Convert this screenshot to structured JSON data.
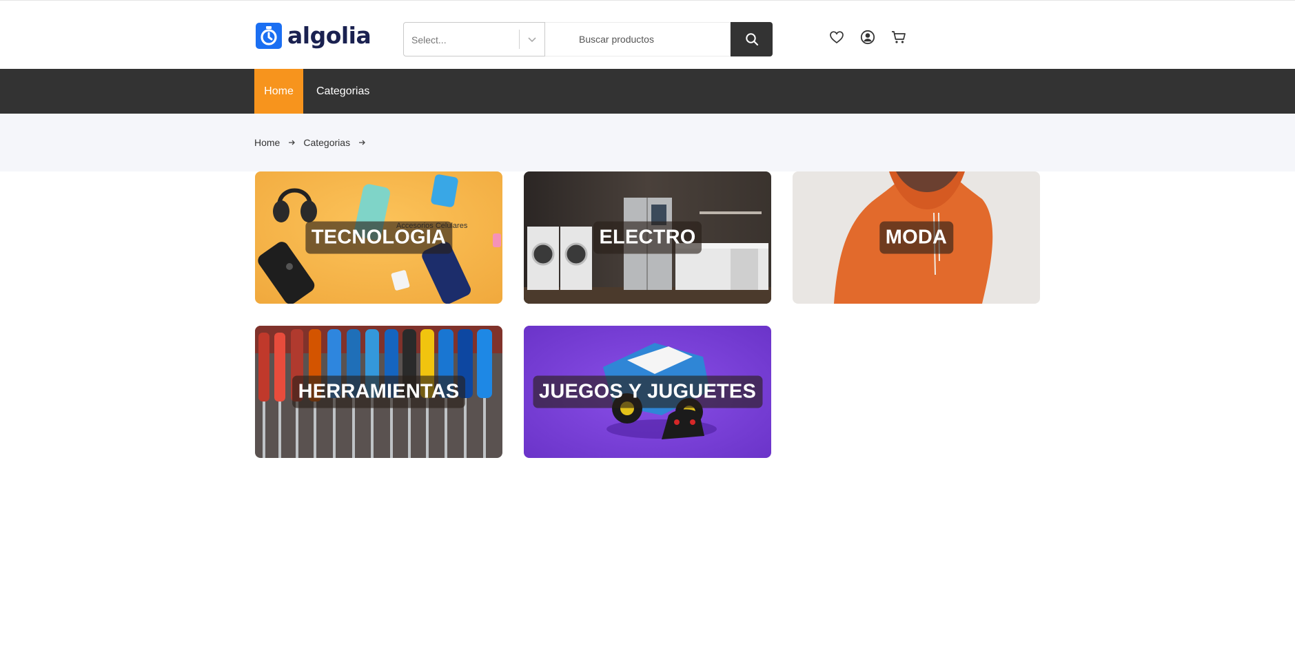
{
  "header": {
    "logo_text": "algolia",
    "select_placeholder": "Select...",
    "search_placeholder": "Buscar productos",
    "icons": [
      "heart-icon",
      "user-icon",
      "cart-icon"
    ]
  },
  "nav": {
    "items": [
      {
        "label": "Home",
        "active": true
      },
      {
        "label": "Categorias",
        "active": false
      }
    ],
    "active_color": "#f7941d",
    "bar_color": "#333333"
  },
  "breadcrumb": {
    "items": [
      "Home",
      "Categorias"
    ]
  },
  "categories": [
    {
      "label": "TECNOLOGIA",
      "image": "phone accessories on yellow background"
    },
    {
      "label": "ELECTRO",
      "image": "kitchen appliances"
    },
    {
      "label": "MODA",
      "image": "orange hoodie"
    },
    {
      "label": "HERRAMIENTAS",
      "image": "screwdriver set"
    },
    {
      "label": "JUEGOS Y JUGUETES",
      "image": "rc toy truck on purple background"
    }
  ],
  "tile_texts": {
    "tecnologia_overlay": "Accesorios Celulares"
  }
}
